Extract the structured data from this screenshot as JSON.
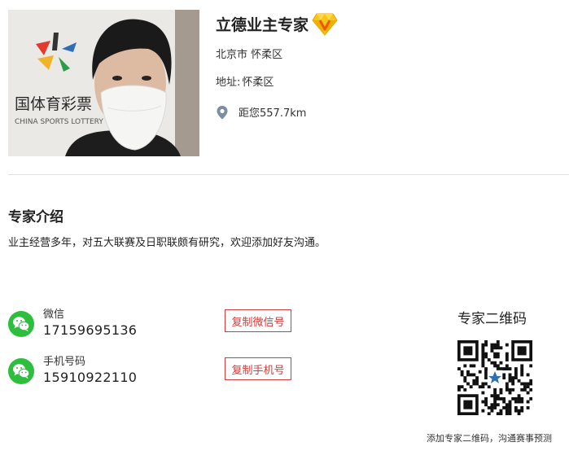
{
  "expert": {
    "name": "立德业主专家",
    "badge_icon": "diamond-vip-icon",
    "city": "北京市 怀柔区",
    "address_label": "地址:",
    "address": "怀柔区",
    "distance_icon": "location-pin-icon",
    "distance": "距您557.7km",
    "photo_sign_text": "国体育彩票",
    "photo_sign_sub": "CHINA SPORTS LOTTERY"
  },
  "intro": {
    "title": "专家介绍",
    "text": "业主经营多年，对五大联赛及日职联颇有研究，欢迎添加好友沟通。"
  },
  "contacts": [
    {
      "label": "微信",
      "value": "17159695136",
      "button": "复制微信号",
      "icon": "wechat-icon"
    },
    {
      "label": "手机号码",
      "value": "15910922110",
      "button": "复制手机号",
      "icon": "wechat-icon"
    }
  ],
  "qr": {
    "title": "专家二维码",
    "caption": "添加专家二维码，沟通赛事预测"
  },
  "colors": {
    "accent_red": "#d23b3b",
    "wechat_green": "#2dbe3d",
    "pin_blue": "#7a8fa6"
  }
}
